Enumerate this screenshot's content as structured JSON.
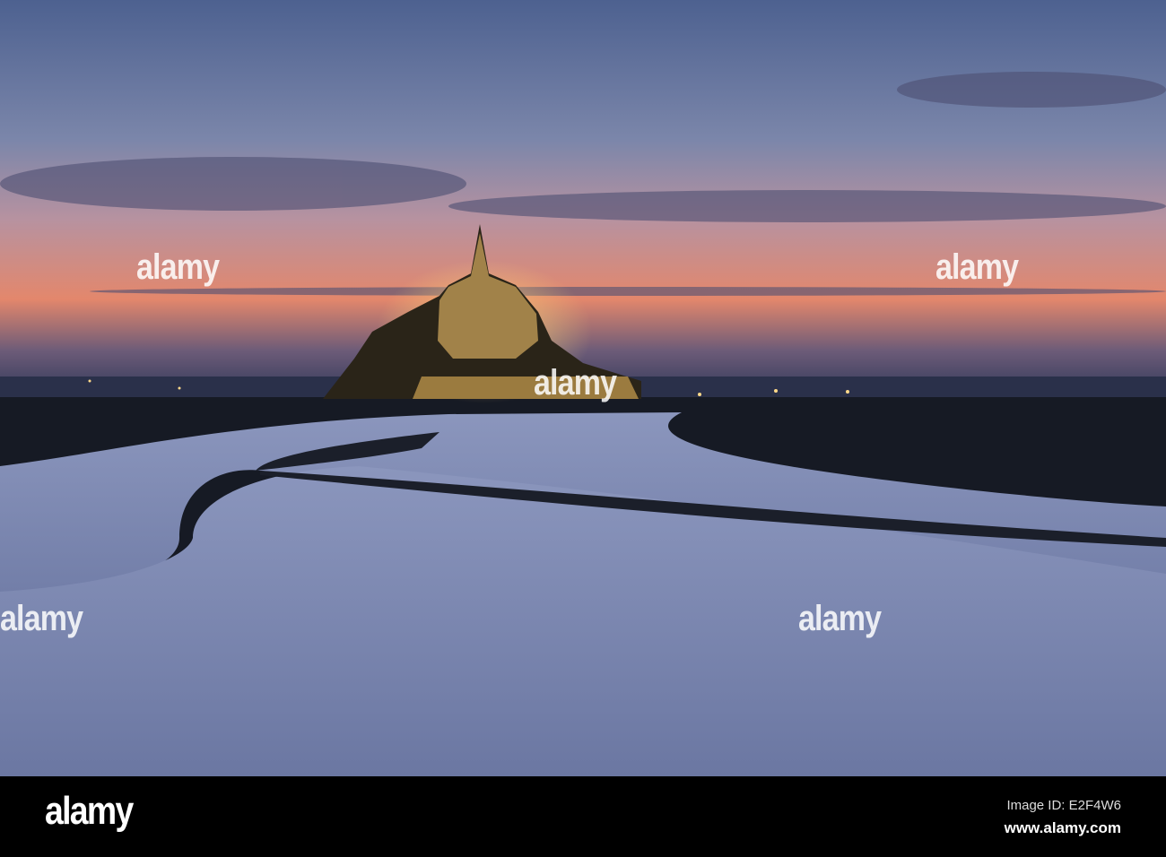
{
  "photo": {
    "subject": "Mont Saint-Michel at dusk"
  },
  "watermark": {
    "text": "alamy"
  },
  "footer": {
    "logo": "alamy",
    "image_id": "Image ID: E2F4W6",
    "website": "www.alamy.com"
  },
  "colors": {
    "sky_top": "#4f6391",
    "sky_glow": "#e3876c",
    "water": "#7c89b0",
    "land": "#161a24",
    "lights": "#f3c567"
  }
}
